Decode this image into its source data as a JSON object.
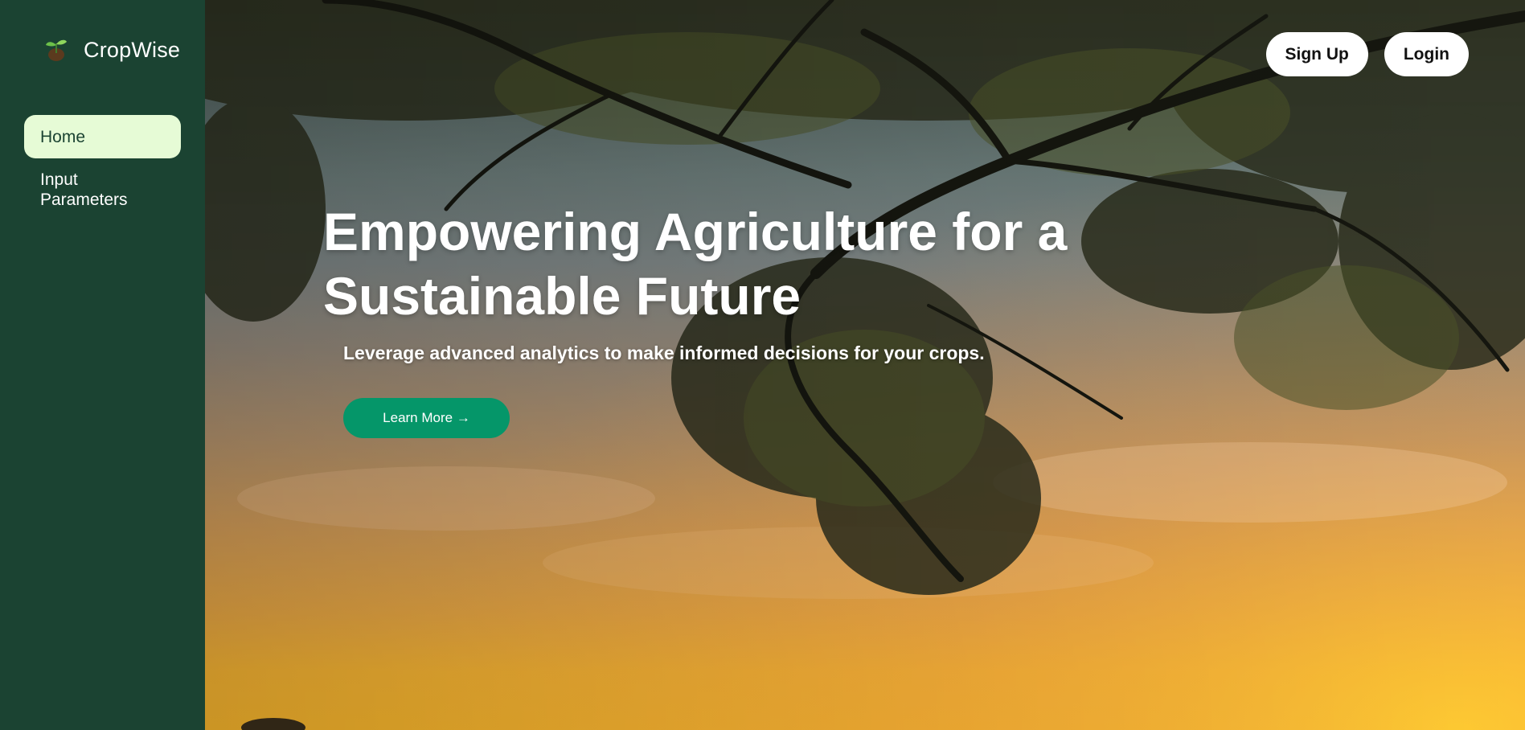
{
  "brand": {
    "name": "CropWise"
  },
  "sidebar": {
    "items": [
      {
        "label": "Home",
        "active": true
      },
      {
        "label": "Input Parameters",
        "active": false
      }
    ]
  },
  "header": {
    "signup_label": "Sign Up",
    "login_label": "Login"
  },
  "hero": {
    "headline": "Empowering Agriculture for a Sustainable Future",
    "subtitle": "Leverage advanced analytics to make informed decisions for your crops.",
    "cta_label": "Learn More →",
    "background": "tree-silhouette-sunset-image"
  },
  "colors": {
    "sidebar_bg": "#1b4332",
    "active_nav_bg": "#e6fbd6",
    "cta_bg": "#059669",
    "auth_button_bg": "#ffffff"
  }
}
